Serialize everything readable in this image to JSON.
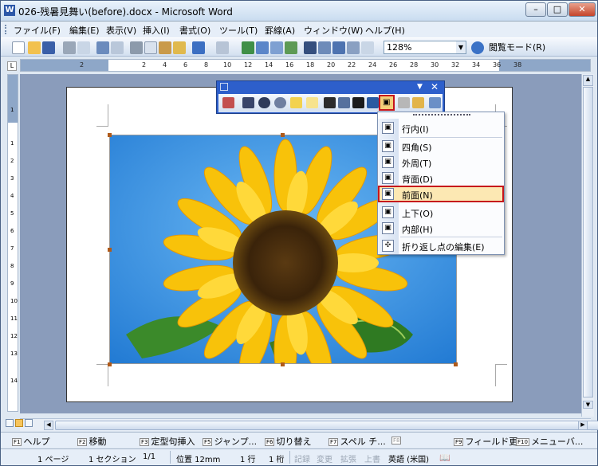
{
  "window": {
    "title": "026-残暑見舞い(before).docx - Microsoft Word",
    "app_icon": "W",
    "controls": {
      "minimize": "–",
      "maximize": "□",
      "close": "✕"
    }
  },
  "menubar": {
    "items": [
      "ファイル(F)",
      "編集(E)",
      "表示(V)",
      "挿入(I)",
      "書式(O)",
      "ツール(T)",
      "罫線(A)",
      "ウィンドウ(W)",
      "ヘルプ(H)"
    ]
  },
  "toolbar": {
    "zoom": "128%",
    "read_mode": "閲覧モード(R)"
  },
  "ruler": {
    "corner": "L",
    "numbers": [
      "2",
      "2",
      "4",
      "6",
      "8",
      "10",
      "12",
      "14",
      "16",
      "18",
      "20",
      "22",
      "24",
      "26",
      "28",
      "30",
      "32",
      "34",
      "36",
      "38"
    ],
    "vnumbers": [
      "1",
      "1",
      "2",
      "3",
      "4",
      "5",
      "6",
      "7",
      "8",
      "9",
      "10",
      "11",
      "12",
      "13",
      "14"
    ]
  },
  "floating_toolbar": {
    "title_icon": "picture-toolbar",
    "controls": {
      "options": "▼",
      "close": "✕"
    }
  },
  "wrap_menu": {
    "items": [
      {
        "label": "行内(I)",
        "icon": "inline-wrap-icon"
      },
      {
        "label": "四角(S)",
        "icon": "square-wrap-icon"
      },
      {
        "label": "外周(T)",
        "icon": "tight-wrap-icon"
      },
      {
        "label": "背面(D)",
        "icon": "behind-text-icon"
      },
      {
        "label": "前面(N)",
        "icon": "in-front-of-text-icon"
      },
      {
        "label": "上下(O)",
        "icon": "top-bottom-wrap-icon"
      },
      {
        "label": "内部(H)",
        "icon": "through-wrap-icon"
      },
      {
        "label": "折り返し点の編集(E)",
        "icon": "edit-wrap-points-icon"
      }
    ],
    "highlighted_index": 4
  },
  "fkeys": [
    {
      "key": "F1",
      "label": "ヘルプ"
    },
    {
      "key": "F2",
      "label": "移動"
    },
    {
      "key": "F3",
      "label": "定型句挿入"
    },
    {
      "key": "F5",
      "label": "ジャンプ..."
    },
    {
      "key": "F6",
      "label": "切り替え"
    },
    {
      "key": "F7",
      "label": "スペル チ..."
    },
    {
      "key": "F8",
      "label": ""
    },
    {
      "key": "F9",
      "label": "フィールド更..."
    },
    {
      "key": "F10",
      "label": "メニューバ..."
    }
  ],
  "status": {
    "page": "1 ページ",
    "section": "1 セクション",
    "pages": "1/1",
    "position": "位置 12mm",
    "line": "1 行",
    "column": "1 桁",
    "rec": "記録",
    "trk": "変更",
    "ext": "拡張",
    "ovr": "上書",
    "language": "英語 (米国)"
  },
  "colors": {
    "sky": "#2f8fe0",
    "highlight_border": "#c6141b",
    "toolbar_blue": "#2d5fcb"
  }
}
